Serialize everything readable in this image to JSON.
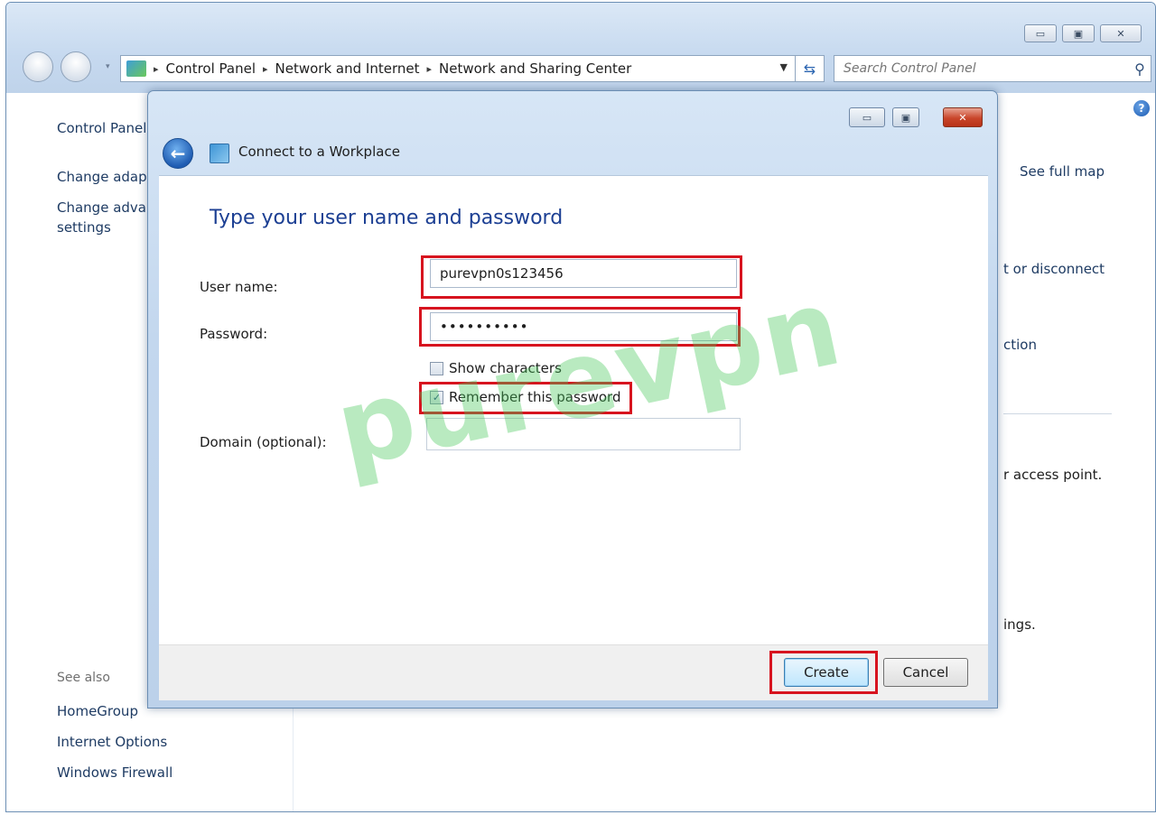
{
  "window": {
    "caption_minimize": "▭",
    "caption_maximize": "▣",
    "caption_close": "✕"
  },
  "navigation": {
    "breadcrumbs": [
      "Control Panel",
      "Network and Internet",
      "Network and Sharing Center"
    ],
    "dropdown_glyph": "▾",
    "refresh_glyph": "⇆",
    "search_placeholder": "Search Control Panel"
  },
  "left_pane": {
    "items": [
      "Control Panel Home",
      "Change adapter settings",
      "Change advanced sharing",
      "settings"
    ],
    "see_also_label": "See also",
    "see_also_items": [
      "HomeGroup",
      "Internet Options",
      "Windows Firewall"
    ]
  },
  "right_pane": {
    "see_full_map": "See full map",
    "connect_disconnect": "t or disconnect",
    "connection": "ction",
    "access_point": "r access point.",
    "settings_tail": "ings."
  },
  "dialog": {
    "title": "Connect to a Workplace",
    "heading": "Type your user name and password",
    "fields": {
      "username_label": "User name:",
      "username_value": "purevpn0s123456",
      "password_label": "Password:",
      "password_value": "••••••••••",
      "domain_label": "Domain (optional):",
      "domain_value": ""
    },
    "checkboxes": {
      "show_characters": {
        "label": "Show characters",
        "checked": false
      },
      "remember_password": {
        "label": "Remember this password",
        "checked": true,
        "mark": "✓"
      }
    },
    "buttons": {
      "create": "Create",
      "cancel": "Cancel"
    },
    "caption_minimize": "▭",
    "caption_maximize": "▣",
    "caption_close": "✕",
    "back_glyph": "←"
  },
  "watermark": "purevpn",
  "colors": {
    "highlight": "#d7141f",
    "link": "#1e3b63",
    "heading": "#1c3f93",
    "watermark": "#46c85a"
  },
  "icons": {
    "back": "back-arrow-icon",
    "search": "magnifier-icon",
    "help": "help-icon",
    "network": "network-icon",
    "workplace": "workplace-icon"
  }
}
